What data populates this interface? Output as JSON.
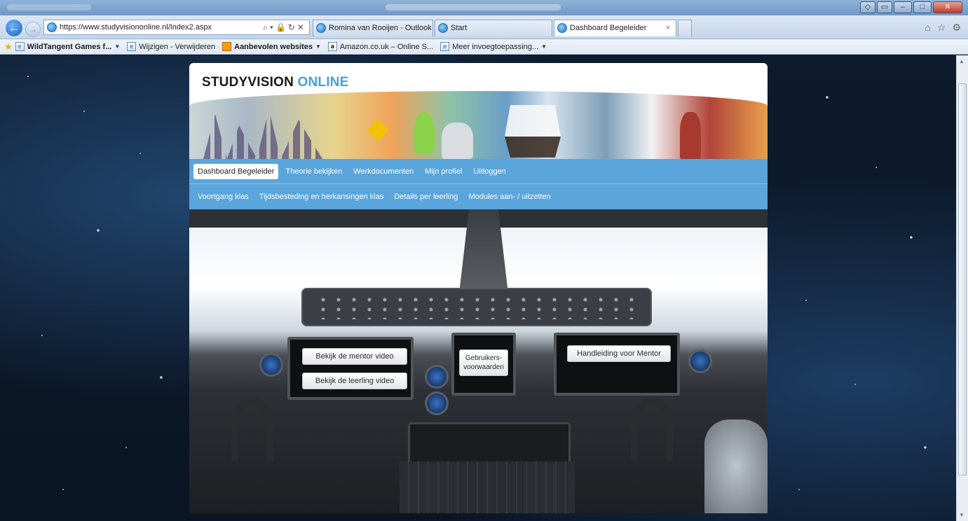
{
  "browser": {
    "address": "https://www.studyvisiononline.nl/Index2.aspx",
    "tabs": [
      {
        "title": "Romina van Rooijen - Outlook ..."
      },
      {
        "title": "Start"
      },
      {
        "title": "Dashboard Begeleider"
      }
    ],
    "window_buttons": {
      "minimize": "–",
      "maximize": "□",
      "close": "✕"
    }
  },
  "favorites": [
    {
      "label": "WildTangent Games f...",
      "bold": true,
      "dropdown": true
    },
    {
      "label": "Wijzigen - Verwijderen",
      "bold": false,
      "dropdown": false
    },
    {
      "label": "Aanbevolen websites",
      "bold": true,
      "dropdown": true
    },
    {
      "label": "Amazon.co.uk – Online S...",
      "bold": false,
      "dropdown": false
    },
    {
      "label": "Meer invoegtoepassing...",
      "bold": false,
      "dropdown": true
    }
  ],
  "site": {
    "logo_main": "STUDYVISION",
    "logo_accent": "ONLINE",
    "accent_color": "#45a1da",
    "nav_color": "#5aa5dc",
    "nav_primary": [
      {
        "label": "Dashboard Begeleider",
        "active": true
      },
      {
        "label": "Theorie bekijken",
        "active": false
      },
      {
        "label": "Werkdocumenten",
        "active": false
      },
      {
        "label": "Mijn profiel",
        "active": false
      },
      {
        "label": "Uitloggen",
        "active": false
      }
    ],
    "nav_secondary": [
      {
        "label": "Voortgang klas"
      },
      {
        "label": "Tijdsbesteding en herkansingen klas"
      },
      {
        "label": "Details per leerling"
      },
      {
        "label": "Modules aan- / uitzetten"
      }
    ],
    "cockpit": {
      "mentor_video": "Bekijk de mentor video",
      "leerling_video": "Bekijk de leerling video",
      "voorwaarden": "Gebruikers-voorwaarden",
      "handleiding": "Handleiding voor Mentor"
    }
  }
}
